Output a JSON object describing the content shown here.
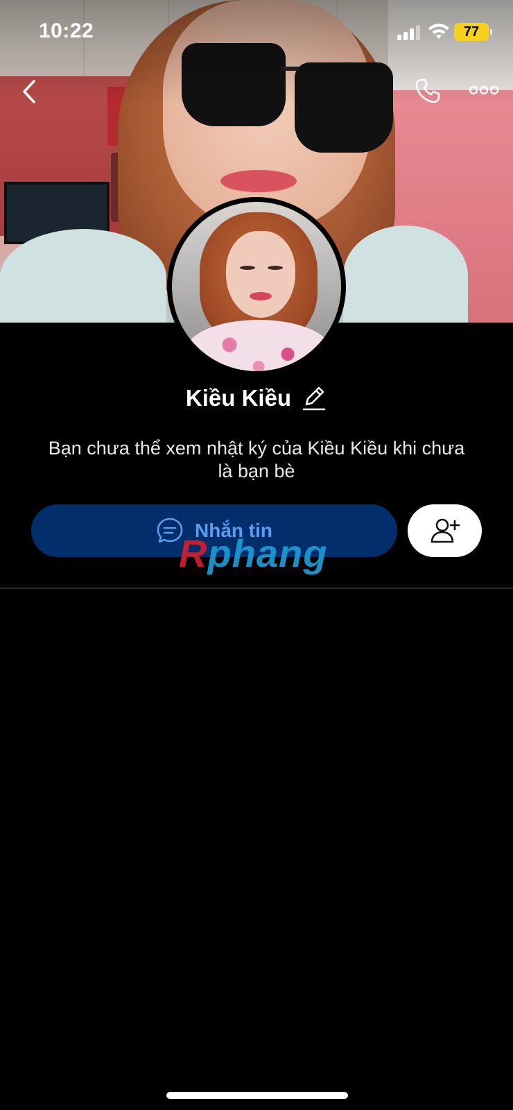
{
  "status_bar": {
    "time": "10:22",
    "battery": "77",
    "battery_color": "#f7d21d"
  },
  "nav": {
    "back_icon": "chevron-left-icon",
    "call_icon": "phone-icon",
    "more_icon": "more-horizontal-icon"
  },
  "profile": {
    "name": "Kiều Kiều",
    "notice": "Bạn chưa thể xem nhật ký của Kiều Kiều khi chưa là bạn bè"
  },
  "actions": {
    "message_label": "Nhắn tin",
    "message_icon": "chat-bubble-icon",
    "add_friend_icon": "add-friend-icon",
    "message_button_color": "#022e6b",
    "message_text_color": "#5d9bf1"
  },
  "watermark": {
    "part1": "R",
    "part2": "phang"
  }
}
